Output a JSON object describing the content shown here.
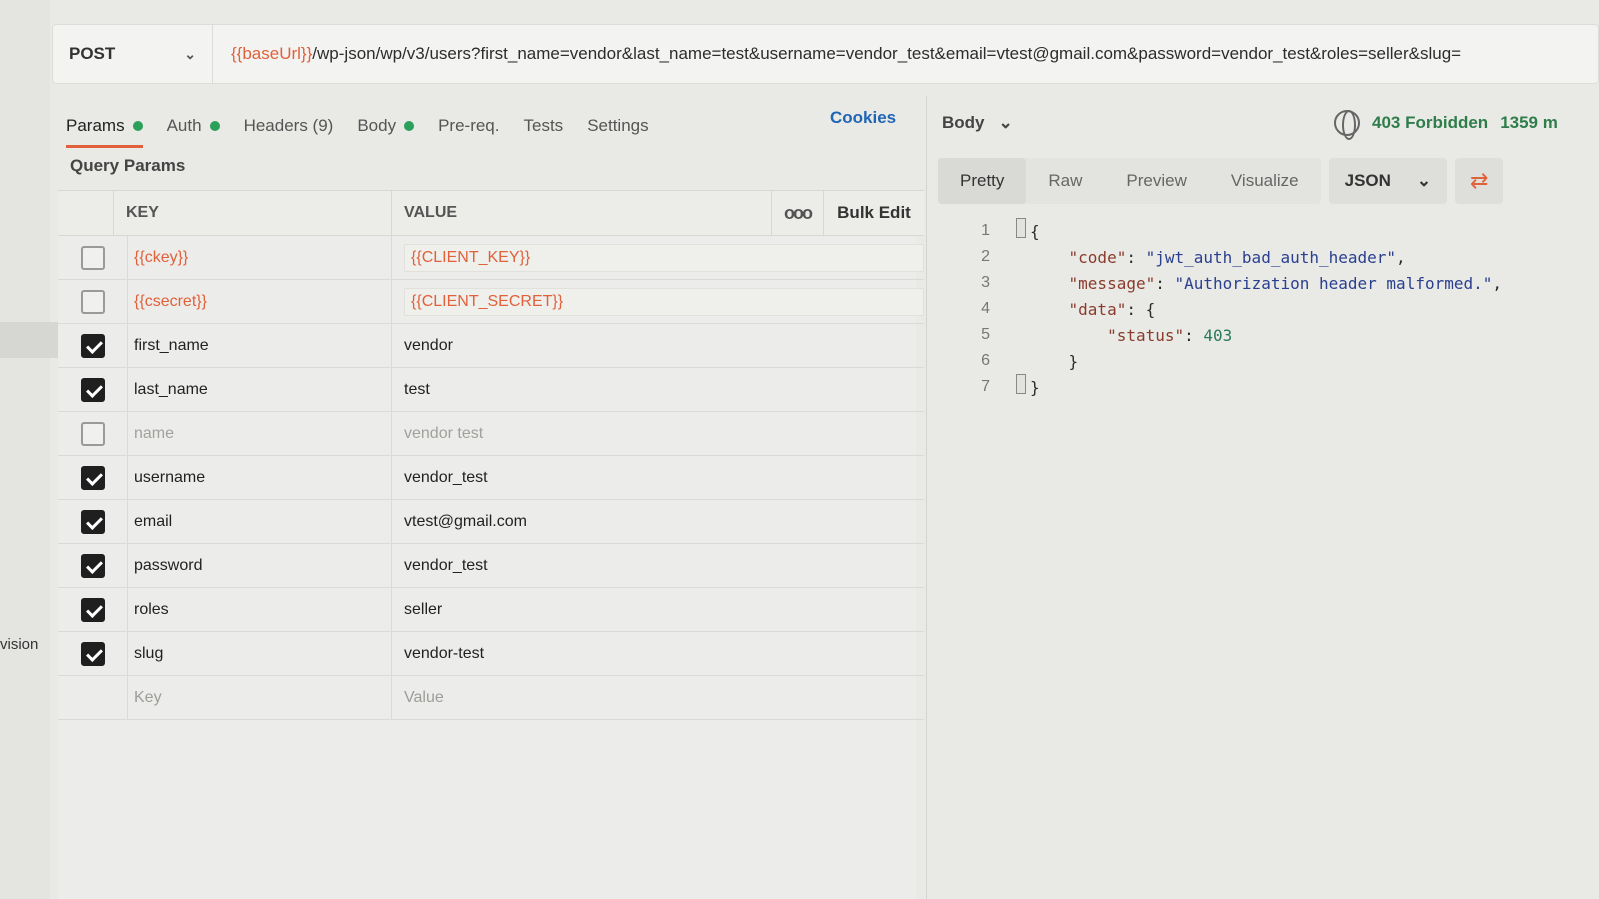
{
  "sidebar": {
    "partial_label": "vision"
  },
  "request": {
    "method": "POST",
    "url_var": "{{baseUrl}}",
    "url_rest": "/wp-json/wp/v3/users?first_name=vendor&last_name=test&username=vendor_test&email=vtest@gmail.com&password=vendor_test&roles=seller&slug="
  },
  "tabs": [
    {
      "label": "Params",
      "dot": true
    },
    {
      "label": "Auth",
      "dot": true
    },
    {
      "label": "Headers (9)",
      "dot": false
    },
    {
      "label": "Body",
      "dot": true
    },
    {
      "label": "Pre-req.",
      "dot": false
    },
    {
      "label": "Tests",
      "dot": false
    },
    {
      "label": "Settings",
      "dot": false
    }
  ],
  "cookies_label": "Cookies",
  "query_params_title": "Query Params",
  "table": {
    "key_header": "KEY",
    "value_header": "VALUE",
    "more_label": "ooo",
    "bulk_edit_label": "Bulk Edit",
    "rows": [
      {
        "key": "{{ckey}}",
        "value": "{{CLIENT_KEY}}",
        "checked": false,
        "kind": "var"
      },
      {
        "key": "{{csecret}}",
        "value": "{{CLIENT_SECRET}}",
        "checked": false,
        "kind": "var"
      },
      {
        "key": "first_name",
        "value": "vendor",
        "checked": true,
        "kind": "normal"
      },
      {
        "key": "last_name",
        "value": "test",
        "checked": true,
        "kind": "normal"
      },
      {
        "key": "name",
        "value": "vendor test",
        "checked": false,
        "kind": "dis"
      },
      {
        "key": "username",
        "value": "vendor_test",
        "checked": true,
        "kind": "normal"
      },
      {
        "key": "email",
        "value": "vtest@gmail.com",
        "checked": true,
        "kind": "normal"
      },
      {
        "key": "password",
        "value": "vendor_test",
        "checked": true,
        "kind": "normal"
      },
      {
        "key": "roles",
        "value": "seller",
        "checked": true,
        "kind": "normal"
      },
      {
        "key": "slug",
        "value": "vendor-test",
        "checked": true,
        "kind": "normal"
      }
    ],
    "placeholder_key": "Key",
    "placeholder_value": "Value"
  },
  "response": {
    "body_selector": "Body",
    "status": "403 Forbidden",
    "time": "1359 m",
    "view_tabs": [
      "Pretty",
      "Raw",
      "Preview",
      "Visualize"
    ],
    "active_view": "Pretty",
    "format": "JSON",
    "lines": [
      {
        "n": "1",
        "text": "{"
      },
      {
        "n": "2",
        "text": "    \"code\": \"jwt_auth_bad_auth_header\","
      },
      {
        "n": "3",
        "text": "    \"message\": \"Authorization header malformed.\","
      },
      {
        "n": "4",
        "text": "    \"data\": {"
      },
      {
        "n": "5",
        "text": "        \"status\": 403"
      },
      {
        "n": "6",
        "text": "    }"
      },
      {
        "n": "7",
        "text": "}"
      }
    ]
  },
  "colors": {
    "accent": "#e0613a",
    "success": "#2f7d4a",
    "link": "#1f66b5"
  }
}
